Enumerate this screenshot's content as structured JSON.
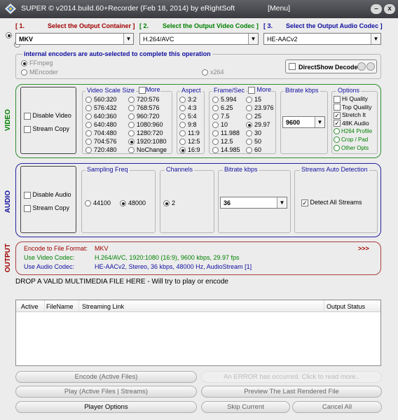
{
  "window": {
    "title": "SUPER © v2014.build.60+Recorder (Feb 18, 2014) by eRightSoft",
    "menu_label": "[Menu]",
    "btn_min": "–",
    "btn_close": "x"
  },
  "output_container": {
    "num": "[ 1.",
    "label": "Select the Output Container ]",
    "value": "MKV"
  },
  "video_codec": {
    "num": "[ 2.",
    "label": "Select the Output Video Codec ]",
    "value": "H.264/AVC"
  },
  "audio_codec": {
    "num": "[ 3.",
    "label": "Select the Output Audio Codec ]",
    "value": "HE-AACv2"
  },
  "encoders": {
    "title": "internal encoders are auto-selected to complete this operation",
    "options": [
      "FFmpeg",
      "MEncoder",
      "x264"
    ],
    "selected": "FFmpeg",
    "directshow": "DirectShow Decode"
  },
  "video": {
    "label": "VIDEO",
    "disable": "Disable Video",
    "stream_copy": "Stream Copy",
    "scale": {
      "title": "Video Scale Size",
      "more": "More",
      "col1": [
        "560:320",
        "576:432",
        "640:360",
        "640:480",
        "704:480",
        "704:576",
        "720:480"
      ],
      "col2": [
        "720:576",
        "768:576",
        "960:720",
        "1080:960",
        "1280:720",
        "1920:1080",
        "NoChange"
      ],
      "selected": "1920:1080"
    },
    "aspect": {
      "title": "Aspect",
      "options": [
        "3:2",
        "4:3",
        "5:4",
        "9:8",
        "11:9",
        "12:5",
        "16:9"
      ],
      "selected": "16:9"
    },
    "frame": {
      "title": "Frame/Sec",
      "more": "More",
      "col1": [
        "5.994",
        "6.25",
        "7.5",
        "10",
        "11.988",
        "12.5",
        "14.985"
      ],
      "col2": [
        "15",
        "23.976",
        "25",
        "29.97",
        "30",
        "50",
        "60"
      ],
      "selected": "29.97"
    },
    "bitrate": {
      "title": "Bitrate  kbps",
      "value": "9600"
    },
    "options": {
      "title": "Options",
      "checks": [
        {
          "label": "Hi Quality",
          "checked": false
        },
        {
          "label": "Top Quality",
          "checked": false
        },
        {
          "label": "Stretch It",
          "checked": true
        },
        {
          "label": "48K Audio",
          "checked": true
        }
      ],
      "links": [
        "H264 Profile",
        "Crop / Pad",
        "Other Opts"
      ]
    }
  },
  "audio": {
    "label": "AUDIO",
    "disable": "Disable Audio",
    "stream_copy": "Stream Copy",
    "freq": {
      "title": "Sampling Freq",
      "options": [
        "44100",
        "48000"
      ],
      "selected": "48000"
    },
    "channels": {
      "title": "Channels",
      "options": [
        "2"
      ],
      "selected": "2"
    },
    "bitrate": {
      "title": "Bitrate  kbps",
      "value": "36"
    },
    "streams": {
      "title": "Streams Auto Detection",
      "detect": "Detect All Streams",
      "checked": true
    }
  },
  "output": {
    "label": "OUTPUT",
    "more": ">>>",
    "rows": [
      {
        "label": "Encode to File Format:",
        "value": "MKV",
        "color": "#a00000"
      },
      {
        "label": "Use Video Codec:",
        "value": "H.264/AVC,   1920:1080 (16:9),   9600 kbps,   29.97 fps",
        "color": "#008000"
      },
      {
        "label": "Use Audio Codec:",
        "value": "HE-AACv2,   Stereo,   36 kbps,   48000 Hz,   AudioStream [1]",
        "color": "#1010a0"
      }
    ]
  },
  "drop_text": "DROP A VALID MULTIMEDIA FILE HERE - Will try to play or encode",
  "table": {
    "headers": [
      "Active",
      "FileName",
      "Streaming Link",
      "Output Status"
    ]
  },
  "buttons": {
    "encode": "Encode (Active Files)",
    "error": "An ERROR has occurred. Click to read more..",
    "play": "Play (Active Files | Streams)",
    "preview": "Preview The Last Rendered File",
    "player_options": "Player Options",
    "skip": "Skip Current",
    "cancel": "Cancel All"
  },
  "colors": {
    "video_border": "#2f8f2f",
    "audio_border": "#2323a0",
    "output_border": "#a84040"
  }
}
